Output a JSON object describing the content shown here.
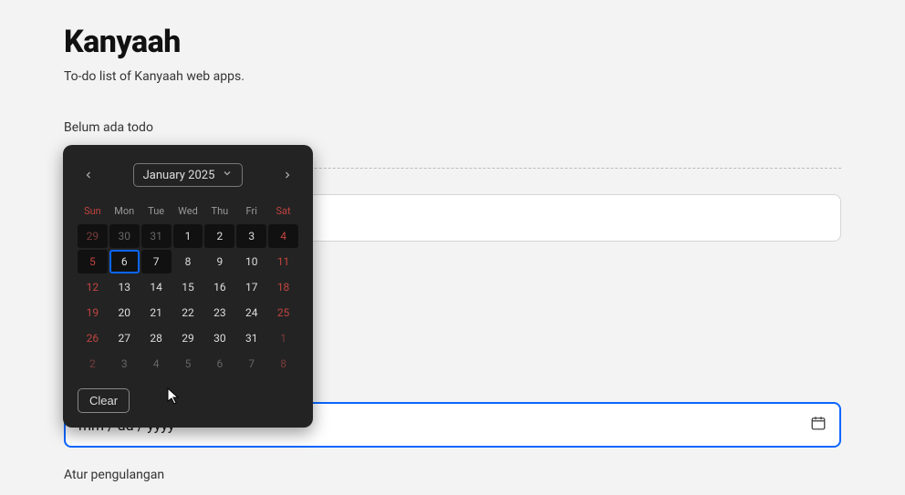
{
  "page": {
    "title": "Kanyaah",
    "subtitle": "To-do list of Kanyaah web apps.",
    "empty_label": "Belum ada todo",
    "date_placeholder": "mm / dd / yyyy",
    "repeat_label": "Atur pengulangan"
  },
  "datepicker": {
    "month_label": "January 2025",
    "clear_label": "Clear",
    "dow": [
      "Sun",
      "Mon",
      "Tue",
      "Wed",
      "Thu",
      "Fri",
      "Sat"
    ],
    "cells": [
      {
        "n": "29",
        "cls": "other-month weekend dark"
      },
      {
        "n": "30",
        "cls": "other-month dark"
      },
      {
        "n": "31",
        "cls": "other-month dark"
      },
      {
        "n": "1",
        "cls": "dark"
      },
      {
        "n": "2",
        "cls": "dark"
      },
      {
        "n": "3",
        "cls": "dark"
      },
      {
        "n": "4",
        "cls": "weekend dark"
      },
      {
        "n": "5",
        "cls": "weekend dark"
      },
      {
        "n": "6",
        "cls": "selected"
      },
      {
        "n": "7",
        "cls": "dark"
      },
      {
        "n": "8",
        "cls": ""
      },
      {
        "n": "9",
        "cls": ""
      },
      {
        "n": "10",
        "cls": ""
      },
      {
        "n": "11",
        "cls": "weekend"
      },
      {
        "n": "12",
        "cls": "weekend"
      },
      {
        "n": "13",
        "cls": ""
      },
      {
        "n": "14",
        "cls": ""
      },
      {
        "n": "15",
        "cls": ""
      },
      {
        "n": "16",
        "cls": ""
      },
      {
        "n": "17",
        "cls": ""
      },
      {
        "n": "18",
        "cls": "weekend"
      },
      {
        "n": "19",
        "cls": "weekend"
      },
      {
        "n": "20",
        "cls": ""
      },
      {
        "n": "21",
        "cls": ""
      },
      {
        "n": "22",
        "cls": ""
      },
      {
        "n": "23",
        "cls": ""
      },
      {
        "n": "24",
        "cls": ""
      },
      {
        "n": "25",
        "cls": "weekend"
      },
      {
        "n": "26",
        "cls": "weekend"
      },
      {
        "n": "27",
        "cls": ""
      },
      {
        "n": "28",
        "cls": ""
      },
      {
        "n": "29",
        "cls": ""
      },
      {
        "n": "30",
        "cls": ""
      },
      {
        "n": "31",
        "cls": ""
      },
      {
        "n": "1",
        "cls": "other-month weekend"
      },
      {
        "n": "2",
        "cls": "other-month weekend"
      },
      {
        "n": "3",
        "cls": "other-month"
      },
      {
        "n": "4",
        "cls": "other-month"
      },
      {
        "n": "5",
        "cls": "other-month"
      },
      {
        "n": "6",
        "cls": "other-month"
      },
      {
        "n": "7",
        "cls": "other-month"
      },
      {
        "n": "8",
        "cls": "other-month weekend"
      }
    ]
  }
}
